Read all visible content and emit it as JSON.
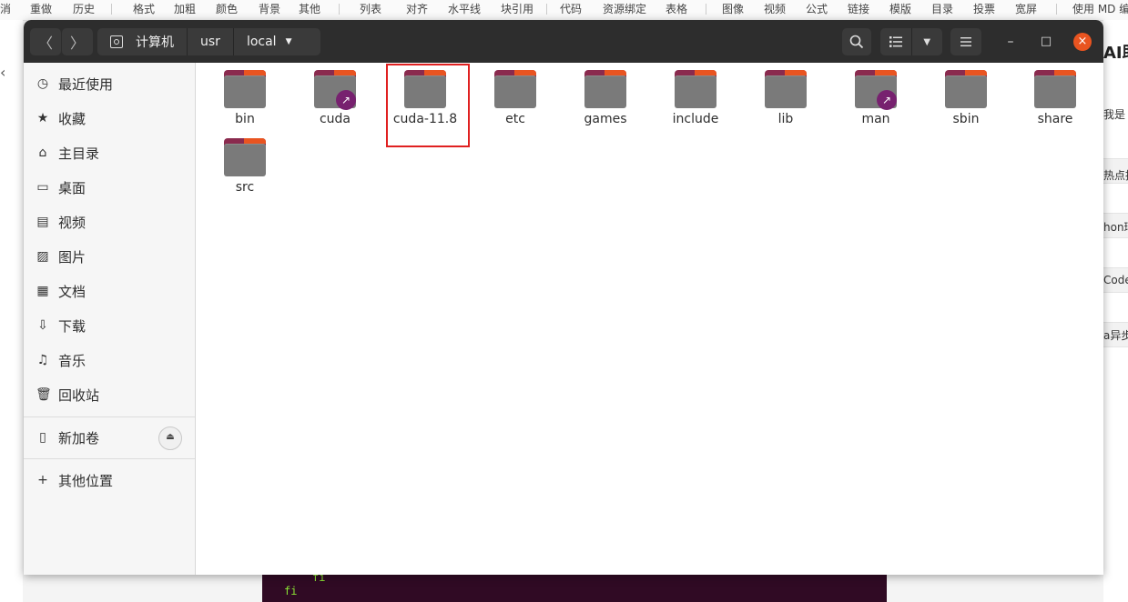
{
  "background_app": {
    "toolbar_items": [
      "消",
      "重做",
      "历史",
      "格式",
      "加粗",
      "颜色",
      "背景",
      "其他",
      "列表",
      "对齐",
      "水平线",
      "块引用",
      "代码",
      "资源绑定",
      "表格",
      "图像",
      "视频",
      "公式",
      "链接",
      "模版",
      "目录",
      "投票",
      "宽屏",
      "使用 MD 编"
    ],
    "right_panel": {
      "heading": "AI助",
      "lines": [
        "我是",
        "热点推",
        "hon环",
        "Code",
        "a异步"
      ]
    },
    "terminal_lines": [
      "fi",
      "fi"
    ]
  },
  "window": {
    "nav_back": "〈",
    "nav_forward": "〉",
    "breadcrumb": [
      "计算机",
      "usr",
      "local"
    ],
    "breadcrumb_dropdown": "▼",
    "search_icon": "search-icon",
    "view_list_icon": "list-view-icon",
    "view_dropdown": "▼",
    "menu_icon": "hamburger-menu-icon",
    "minimize": "–",
    "maximize": "□",
    "close": "×",
    "accent_color": "#e95420"
  },
  "sidebar": {
    "items": [
      {
        "label": "最近使用",
        "icon": "◷"
      },
      {
        "label": "收藏",
        "icon": "★"
      },
      {
        "label": "主目录",
        "icon": "⌂"
      },
      {
        "label": "桌面",
        "icon": "▭"
      },
      {
        "label": "视频",
        "icon": "▤"
      },
      {
        "label": "图片",
        "icon": "▨"
      },
      {
        "label": "文档",
        "icon": "▦"
      },
      {
        "label": "下载",
        "icon": "⇩"
      },
      {
        "label": "音乐",
        "icon": "♫"
      },
      {
        "label": "回收站",
        "icon": "🗑"
      }
    ],
    "volume": {
      "label": "新加卷",
      "icon": "▯",
      "eject": "⏏"
    },
    "other": {
      "label": "其他位置",
      "icon": "+"
    }
  },
  "files": [
    {
      "name": "bin",
      "link": false
    },
    {
      "name": "cuda",
      "link": true
    },
    {
      "name": "cuda-11.8",
      "link": false,
      "highlighted": true
    },
    {
      "name": "etc",
      "link": false
    },
    {
      "name": "games",
      "link": false
    },
    {
      "name": "include",
      "link": false
    },
    {
      "name": "lib",
      "link": false
    },
    {
      "name": "man",
      "link": true
    },
    {
      "name": "sbin",
      "link": false
    },
    {
      "name": "share",
      "link": false
    },
    {
      "name": "src",
      "link": false
    }
  ],
  "link_badge": "↗"
}
